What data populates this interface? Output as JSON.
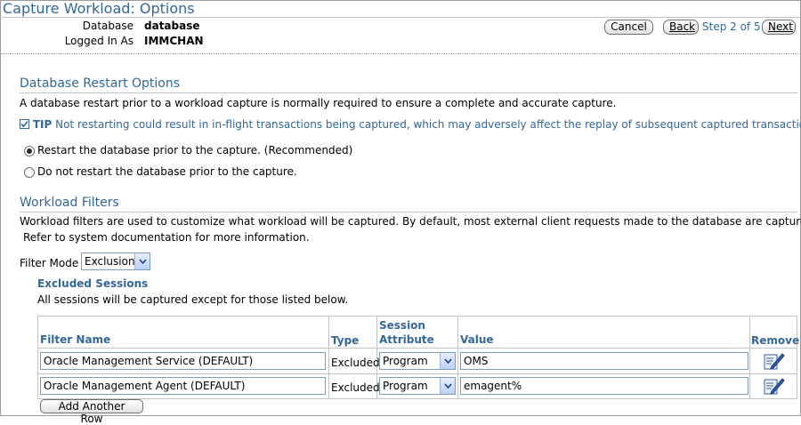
{
  "header": {
    "title": "Capture Workload: Options",
    "database_label": "Database",
    "database_value": "database",
    "logged_in_label": "Logged In As",
    "logged_in_value": "IMMCHAN"
  },
  "toolbar": {
    "cancel_label": "Cancel",
    "back_label": "Back",
    "step_text": "Step 2 of 5",
    "next_label": "Next"
  },
  "restart_section": {
    "title": "Database Restart Options",
    "description": "A database restart prior to a workload capture is normally required to ensure a complete and accurate capture.",
    "tip_label": "TIP",
    "tip_text": "Not restarting could result in in-flight transactions being captured, which may adversely affect the replay of subsequent captured transactions.",
    "options": [
      {
        "label": "Restart the database prior to the capture. (Recommended)",
        "selected": true
      },
      {
        "label": "Do not restart the database prior to the capture.",
        "selected": false
      }
    ]
  },
  "filters_section": {
    "title": "Workload Filters",
    "description_line1": "Workload filters are used to customize what workload will be captured. By default, most external client requests made to the database are captured.",
    "description_line2": "Refer to system documentation for more information.",
    "filter_mode_label": "Filter Mode",
    "filter_mode_value": "Exclusion",
    "excluded_title": "Excluded Sessions",
    "excluded_description": "All sessions will be captured except for those listed below.",
    "columns": {
      "filter_name": "Filter Name",
      "type": "Type",
      "session_attribute_line1": "Session",
      "session_attribute_line2": "Attribute",
      "value": "Value",
      "remove": "Remove"
    },
    "rows": [
      {
        "filter_name": "Oracle Management Service (DEFAULT)",
        "type": "Excluded",
        "attribute": "Program",
        "value": "OMS",
        "remove_icon": "edit-icon"
      },
      {
        "filter_name": "Oracle Management Agent (DEFAULT)",
        "type": "Excluded",
        "attribute": "Program",
        "value": "emagent%",
        "remove_icon": "edit-icon"
      }
    ],
    "add_row_label": "Add Another Row"
  },
  "colors": {
    "accent": "#336699",
    "rule": "#c4c4c4"
  }
}
